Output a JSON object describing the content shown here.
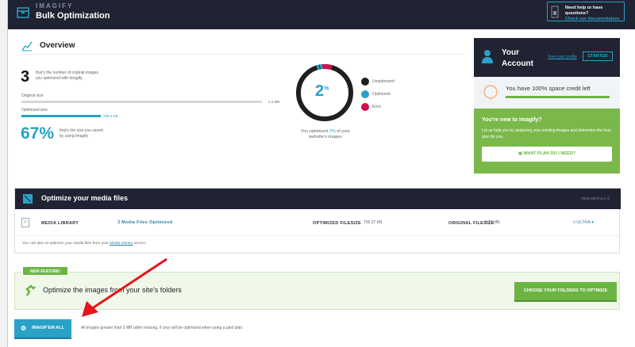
{
  "header": {
    "brand": "IMAGIFY",
    "title": "Bulk Optimization",
    "help_text": "Need help or have questions?",
    "help_link": "Check our documentation."
  },
  "overview": {
    "title": "Overview",
    "count": "3",
    "count_desc_1": "that's the number of original images",
    "count_desc_2": "you optimized with Imagify",
    "original_label": "Original size",
    "original_value": "2.2 MB",
    "optimized_label": "Optimized size",
    "optimized_value": "756.4 KB",
    "optimized_fraction": 0.33,
    "saved_pct": "67%",
    "saved_desc_1": "that's the size you saved",
    "saved_desc_2": "by using Imagify",
    "donut_value": "2",
    "donut_unit": "%",
    "donut_caption_pre": "You optimized ",
    "donut_caption_pct": "2%",
    "donut_caption_post": " of your",
    "donut_caption_2": "website's images",
    "legend": [
      {
        "label": "Unoptimized",
        "color": "#1f1f1f"
      },
      {
        "label": "Optimized",
        "color": "#2aa1c6"
      },
      {
        "label": "Error",
        "color": "#d0104c"
      }
    ]
  },
  "account": {
    "title_1": "Your",
    "title_2": "Account",
    "profile_link": "View your profile",
    "plan": "STARTER",
    "credit_text": "You have 100% space credit left",
    "credit_fraction": 1.0,
    "new_title": "You're new to Imagify?",
    "new_desc": "Let us help you by analyzing your existing images and determine the best plan for you.",
    "plan_button": "WHAT PLAN DO I NEED?"
  },
  "media": {
    "title": "Optimize your media files",
    "view_details": "VIEW DETAILS",
    "row": {
      "name": "MEDIA LIBRARY",
      "status": "3 Media Files Optimized",
      "opt_label": "OPTIMIZED FILESIZE",
      "opt_value": "756.37 KB",
      "orig_label": "ORIGINAL FILESIZE",
      "orig_value": "2.23 MB",
      "level": "ULTRA"
    },
    "note_pre": "You can also re-optimize your media files from your ",
    "note_link": "Media Library",
    "note_post": " screen."
  },
  "feature": {
    "tag": "NEW FEATURE!",
    "text": "Optimize the images from your site's folders",
    "button": "CHOOSE YOUR FOLDERS TO OPTIMIZE"
  },
  "bulk": {
    "button": "IMAGIF'EM ALL",
    "note": "All images greater than 2 MB (after resizing, if any) will be optimized when using a paid plan."
  }
}
